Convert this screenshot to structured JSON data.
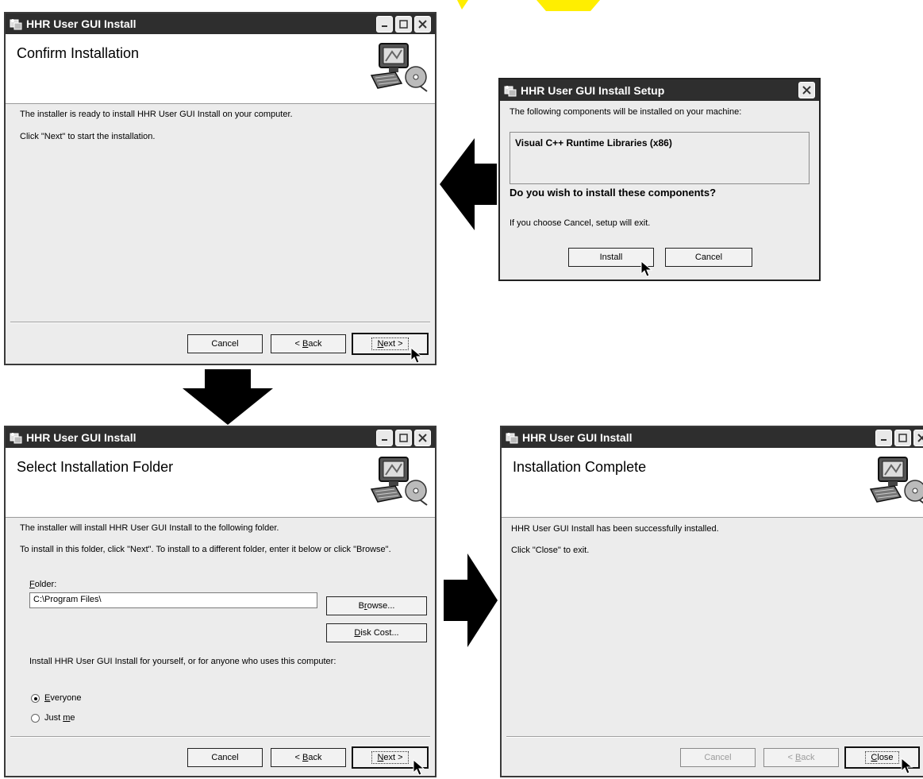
{
  "confirm": {
    "title": "HHR User GUI Install",
    "header": "Confirm Installation",
    "line1": "The installer is ready to install HHR User GUI Install on your computer.",
    "line2": "Click \"Next\" to start the installation.",
    "cancel": "Cancel",
    "back_pre": "< ",
    "back_key": "B",
    "back_post": "ack",
    "next_key": "N",
    "next_post": "ext >"
  },
  "setup": {
    "title": "HHR User GUI Install Setup",
    "intro": "The following components will be installed on your machine:",
    "component": "Visual C++ Runtime Libraries (x86)",
    "question": "Do you wish to install these components?",
    "note": "If you choose Cancel, setup will exit.",
    "install": "Install",
    "cancel": "Cancel"
  },
  "folder": {
    "title": "HHR User GUI Install",
    "header": "Select Installation Folder",
    "line1": "The installer will install HHR User GUI Install to the following folder.",
    "line2": "To install in this folder, click \"Next\". To install to a different folder, enter it below or click \"Browse\".",
    "folder_label_key": "F",
    "folder_label_post": "older:",
    "folder_value": "C:\\Program Files\\",
    "browse_pre": "B",
    "browse_key": "r",
    "browse_post": "owse...",
    "diskcost_key": "D",
    "diskcost_post": "isk Cost...",
    "scope_question": "Install HHR User GUI Install for yourself, or for anyone who uses this computer:",
    "everyone_key": "E",
    "everyone_post": "veryone",
    "justme_pre": "Just ",
    "justme_key": "m",
    "justme_post": "e",
    "cancel": "Cancel",
    "back_pre": "< ",
    "back_key": "B",
    "back_post": "ack",
    "next_key": "N",
    "next_post": "ext >"
  },
  "complete": {
    "title": "HHR User GUI Install",
    "header": "Installation Complete",
    "line1": "HHR User GUI Install has been successfully installed.",
    "line2": "Click \"Close\" to exit.",
    "cancel": "Cancel",
    "back_pre": "< ",
    "back_key": "B",
    "back_post": "ack",
    "close_key": "C",
    "close_post": "lose"
  }
}
